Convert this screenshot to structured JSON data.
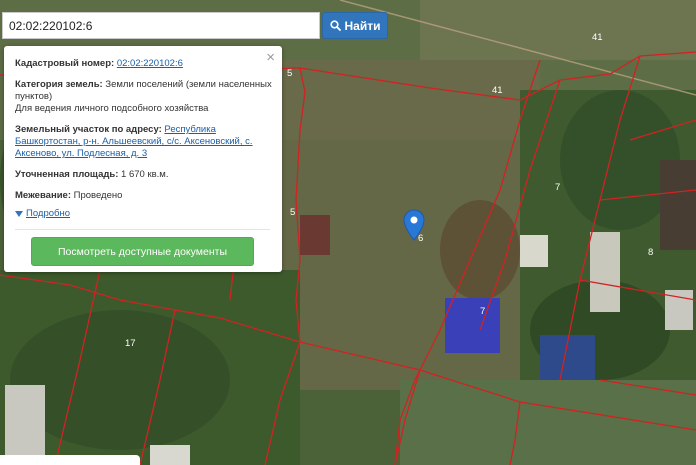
{
  "search": {
    "value": "02:02:220102:6",
    "button_label": "Найти"
  },
  "popup": {
    "cad_label": "Кадастровый номер:",
    "cad_value": "02:02:220102:6",
    "category_label": "Категория земель:",
    "category_value": "Земли поселений (земли населенных пунктов)",
    "usage": "Для ведения личного подсобного хозяйства",
    "address_label": "Земельный участок по адресу:",
    "address_value": "Республика Башкортостан, р-н. Альшеевский, с/с. Аксеновский, с. Аксеново, ул. Подлесная, д. 3",
    "area_label": "Уточненная площадь:",
    "area_value": "1 670 кв.м.",
    "survey_label": "Межевание:",
    "survey_value": "Проведено",
    "details_link": "Подробно",
    "documents_button": "Посмотреть доступные документы",
    "close_glyph": "×"
  },
  "map_labels": {
    "l41a": "41",
    "l41b": "41",
    "l5a": "5",
    "l5b": "5",
    "l7a": "7",
    "l7b": "7",
    "l8": "8",
    "l6": "6",
    "l17": "17"
  },
  "colors": {
    "boundary": "#d22222",
    "accent_button": "#3176bd",
    "docs_button": "#5cb85c",
    "link": "#1a5fa8",
    "marker": "#2a78d6"
  }
}
